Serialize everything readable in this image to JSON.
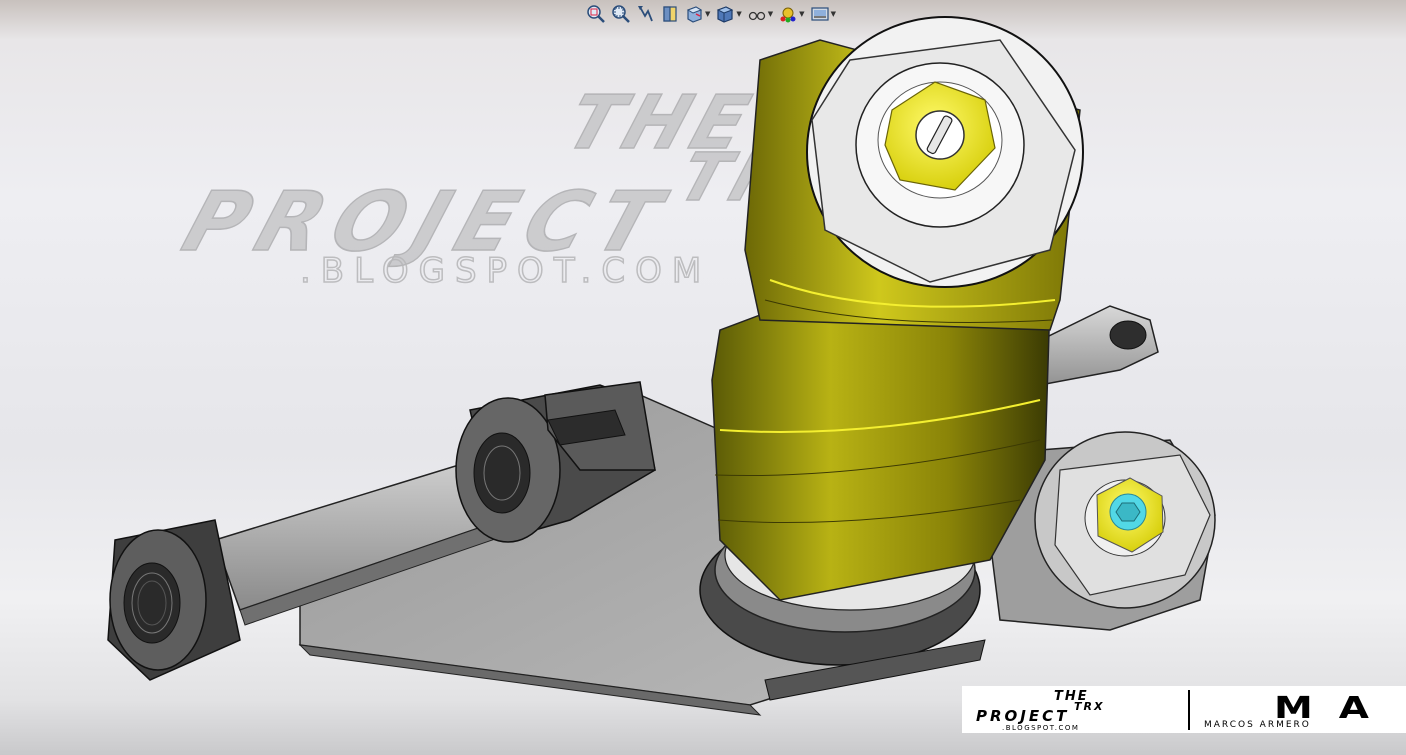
{
  "heads_up_toolbar": {
    "tools": [
      {
        "icon": "zoom-to-fit-icon",
        "has_dropdown": false
      },
      {
        "icon": "zoom-to-area-icon",
        "has_dropdown": false
      },
      {
        "icon": "previous-view-icon",
        "has_dropdown": false
      },
      {
        "icon": "section-view-icon",
        "has_dropdown": false
      },
      {
        "icon": "view-orientation-icon",
        "has_dropdown": true
      },
      {
        "icon": "display-style-icon",
        "has_dropdown": true
      },
      {
        "icon": "hide-show-items-icon",
        "has_dropdown": true
      },
      {
        "icon": "edit-appearance-icon",
        "has_dropdown": true
      },
      {
        "icon": "apply-scene-icon",
        "has_dropdown": true
      }
    ]
  },
  "watermark": {
    "line1": "THE",
    "line2": "TRX",
    "line3": "PROJECT",
    "line4": ".BLOGSPOT.COM"
  },
  "logo_badge": {
    "left_logo": {
      "line1": "THE",
      "line2": "TRX",
      "line3": "PROJECT",
      "line4": ".BLOGSPOT.COM"
    },
    "right_logo": {
      "monogram": "MA",
      "name": "MARCOS ARMERO"
    }
  },
  "colors": {
    "shock_body": "#c9c21a",
    "hardware_metal": "#8a8a8a",
    "bolt_yellow": "#f4ef22",
    "hex_socket_cyan": "#52d8e6",
    "watermark_gray": "#c4c4c6"
  }
}
